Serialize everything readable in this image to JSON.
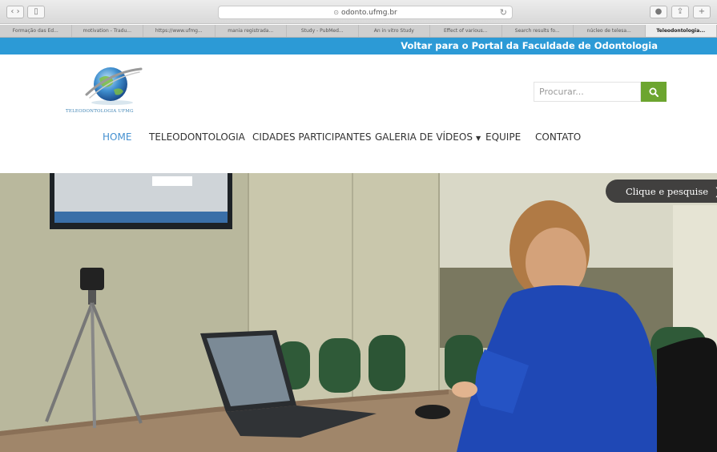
{
  "browser": {
    "url": "odonto.ufmg.br",
    "tabs": [
      "Formação das Ed...",
      "motivation - Tradu...",
      "https://www.ufmg...",
      "mania registrada...",
      "Study - PubMed...",
      "An in vitro Study",
      "Effect of various...",
      "Search results fo...",
      "núcleo de telesa...",
      "Teleodontologia..."
    ],
    "active_tab": 9
  },
  "site": {
    "topbar_link": "Voltar para o Portal da Faculdade de Odontologia",
    "logo_text": "TELEODONTOLOGIA UFMG",
    "search_placeholder": "Procurar...",
    "menu": [
      {
        "label": "HOME",
        "active": true
      },
      {
        "label": "TELEODONTOLOGIA",
        "active": false
      },
      {
        "label": "CIDADES PARTICIPANTES",
        "active": false
      },
      {
        "label": "GALERIA DE VÍDEOS",
        "active": false,
        "dropdown": true
      },
      {
        "label": "EQUIPE",
        "active": false
      },
      {
        "label": "CONTATO",
        "active": false
      }
    ],
    "hero_cta": "Clique e pesquise"
  },
  "colors": {
    "topbar": "#2c9ad6",
    "menu_active": "#4490d0",
    "search_button": "#6ca52f",
    "cta_background": "#303030"
  },
  "icons": {
    "search_button": "search-icon",
    "cta": "chevron-right-icon",
    "dropdown": "caret-down-icon"
  }
}
